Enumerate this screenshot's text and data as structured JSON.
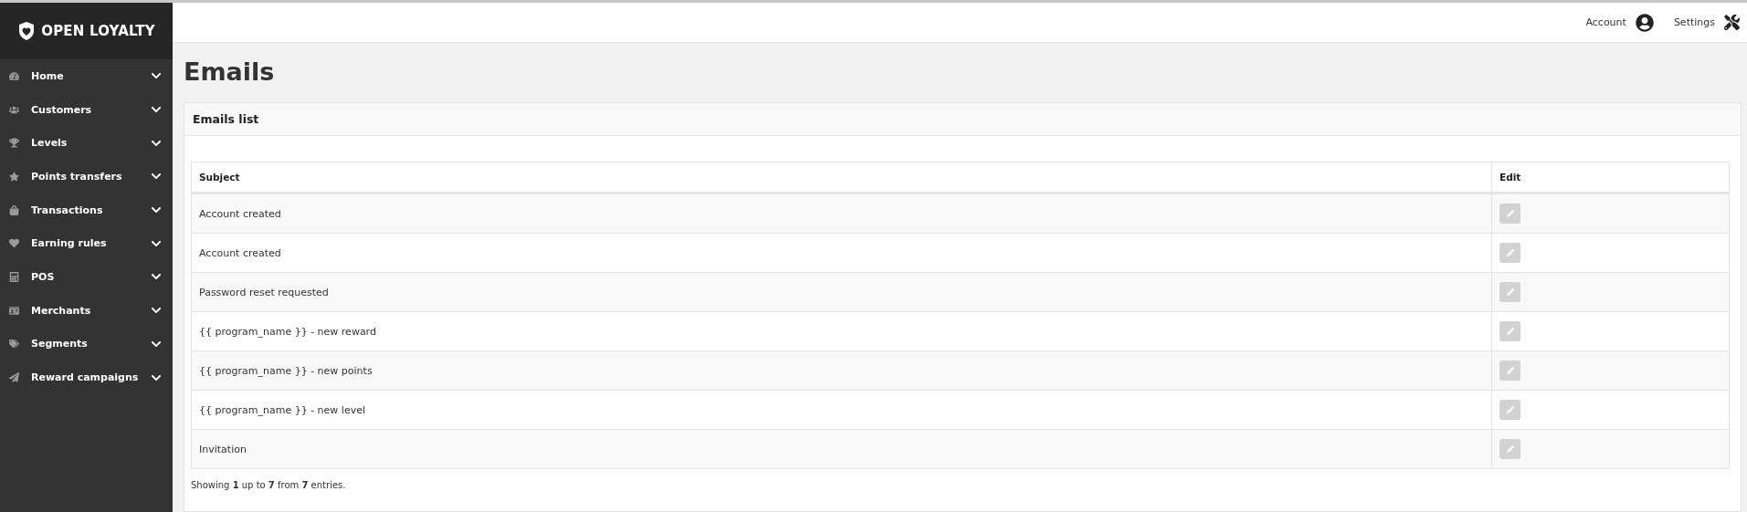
{
  "logo": {
    "text": "OPEN LOYALTY"
  },
  "topbar": {
    "account": "Account",
    "settings": "Settings"
  },
  "sidebar": {
    "items": [
      {
        "kind": "home",
        "label": "Home",
        "expanded": false
      },
      {
        "kind": "customers",
        "label": "Customers",
        "expanded": false
      },
      {
        "kind": "levels",
        "label": "Levels",
        "expanded": false
      },
      {
        "kind": "points",
        "label": "Points transfers",
        "expanded": false
      },
      {
        "kind": "transactions",
        "label": "Transactions",
        "expanded": false
      },
      {
        "kind": "earning",
        "label": "Earning rules",
        "expanded": false
      },
      {
        "kind": "pos",
        "label": "POS",
        "expanded": false
      },
      {
        "kind": "merchants",
        "label": "Merchants",
        "expanded": false
      },
      {
        "kind": "segments",
        "label": "Segments",
        "expanded": false
      },
      {
        "kind": "campaigns",
        "label": "Reward campaigns",
        "expanded": false
      }
    ]
  },
  "page": {
    "title": "Emails"
  },
  "panel": {
    "title": "Emails list"
  },
  "table": {
    "columns": [
      "Subject",
      "Edit"
    ],
    "rows": [
      {
        "subject": "Account created"
      },
      {
        "subject": "Account created"
      },
      {
        "subject": "Password reset requested"
      },
      {
        "subject": "{{ program_name }} - new reward"
      },
      {
        "subject": "{{ program_name }} - new points"
      },
      {
        "subject": "{{ program_name }} - new level"
      },
      {
        "subject": "Invitation"
      }
    ]
  },
  "footer": "Showing **1** up to **7** from **7** entries."
}
